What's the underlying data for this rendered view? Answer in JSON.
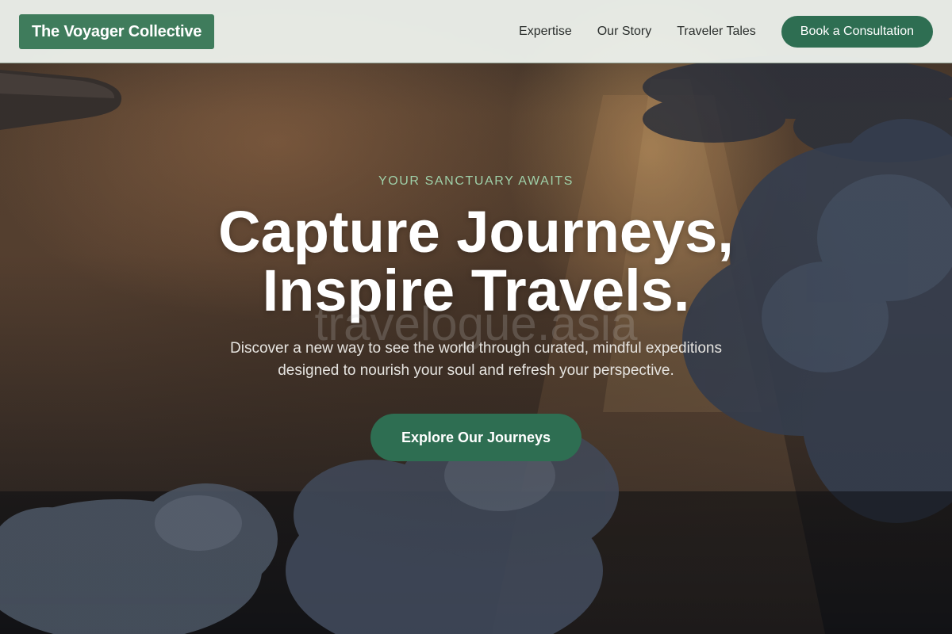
{
  "header": {
    "logo": "The Voyager Collective",
    "nav": [
      {
        "label": "Expertise"
      },
      {
        "label": "Our Story"
      },
      {
        "label": "Traveler Tales"
      }
    ],
    "cta_label": "Book a Consultation"
  },
  "hero": {
    "eyebrow": "YOUR SANCTUARY AWAITS",
    "headline_line1": "Capture Journeys,",
    "headline_line2": "Inspire Travels.",
    "watermark": "travelogue.asia",
    "subtitle": "Discover a new way to see the world through curated, mindful expeditions designed to nourish your soul and refresh your perspective.",
    "cta_label": "Explore Our Journeys"
  },
  "colors": {
    "brand_green": "#2e6e52",
    "logo_green": "#3f7c5c",
    "eyebrow_green": "#9fd0a9",
    "nav_bg": "#eef2ed"
  }
}
